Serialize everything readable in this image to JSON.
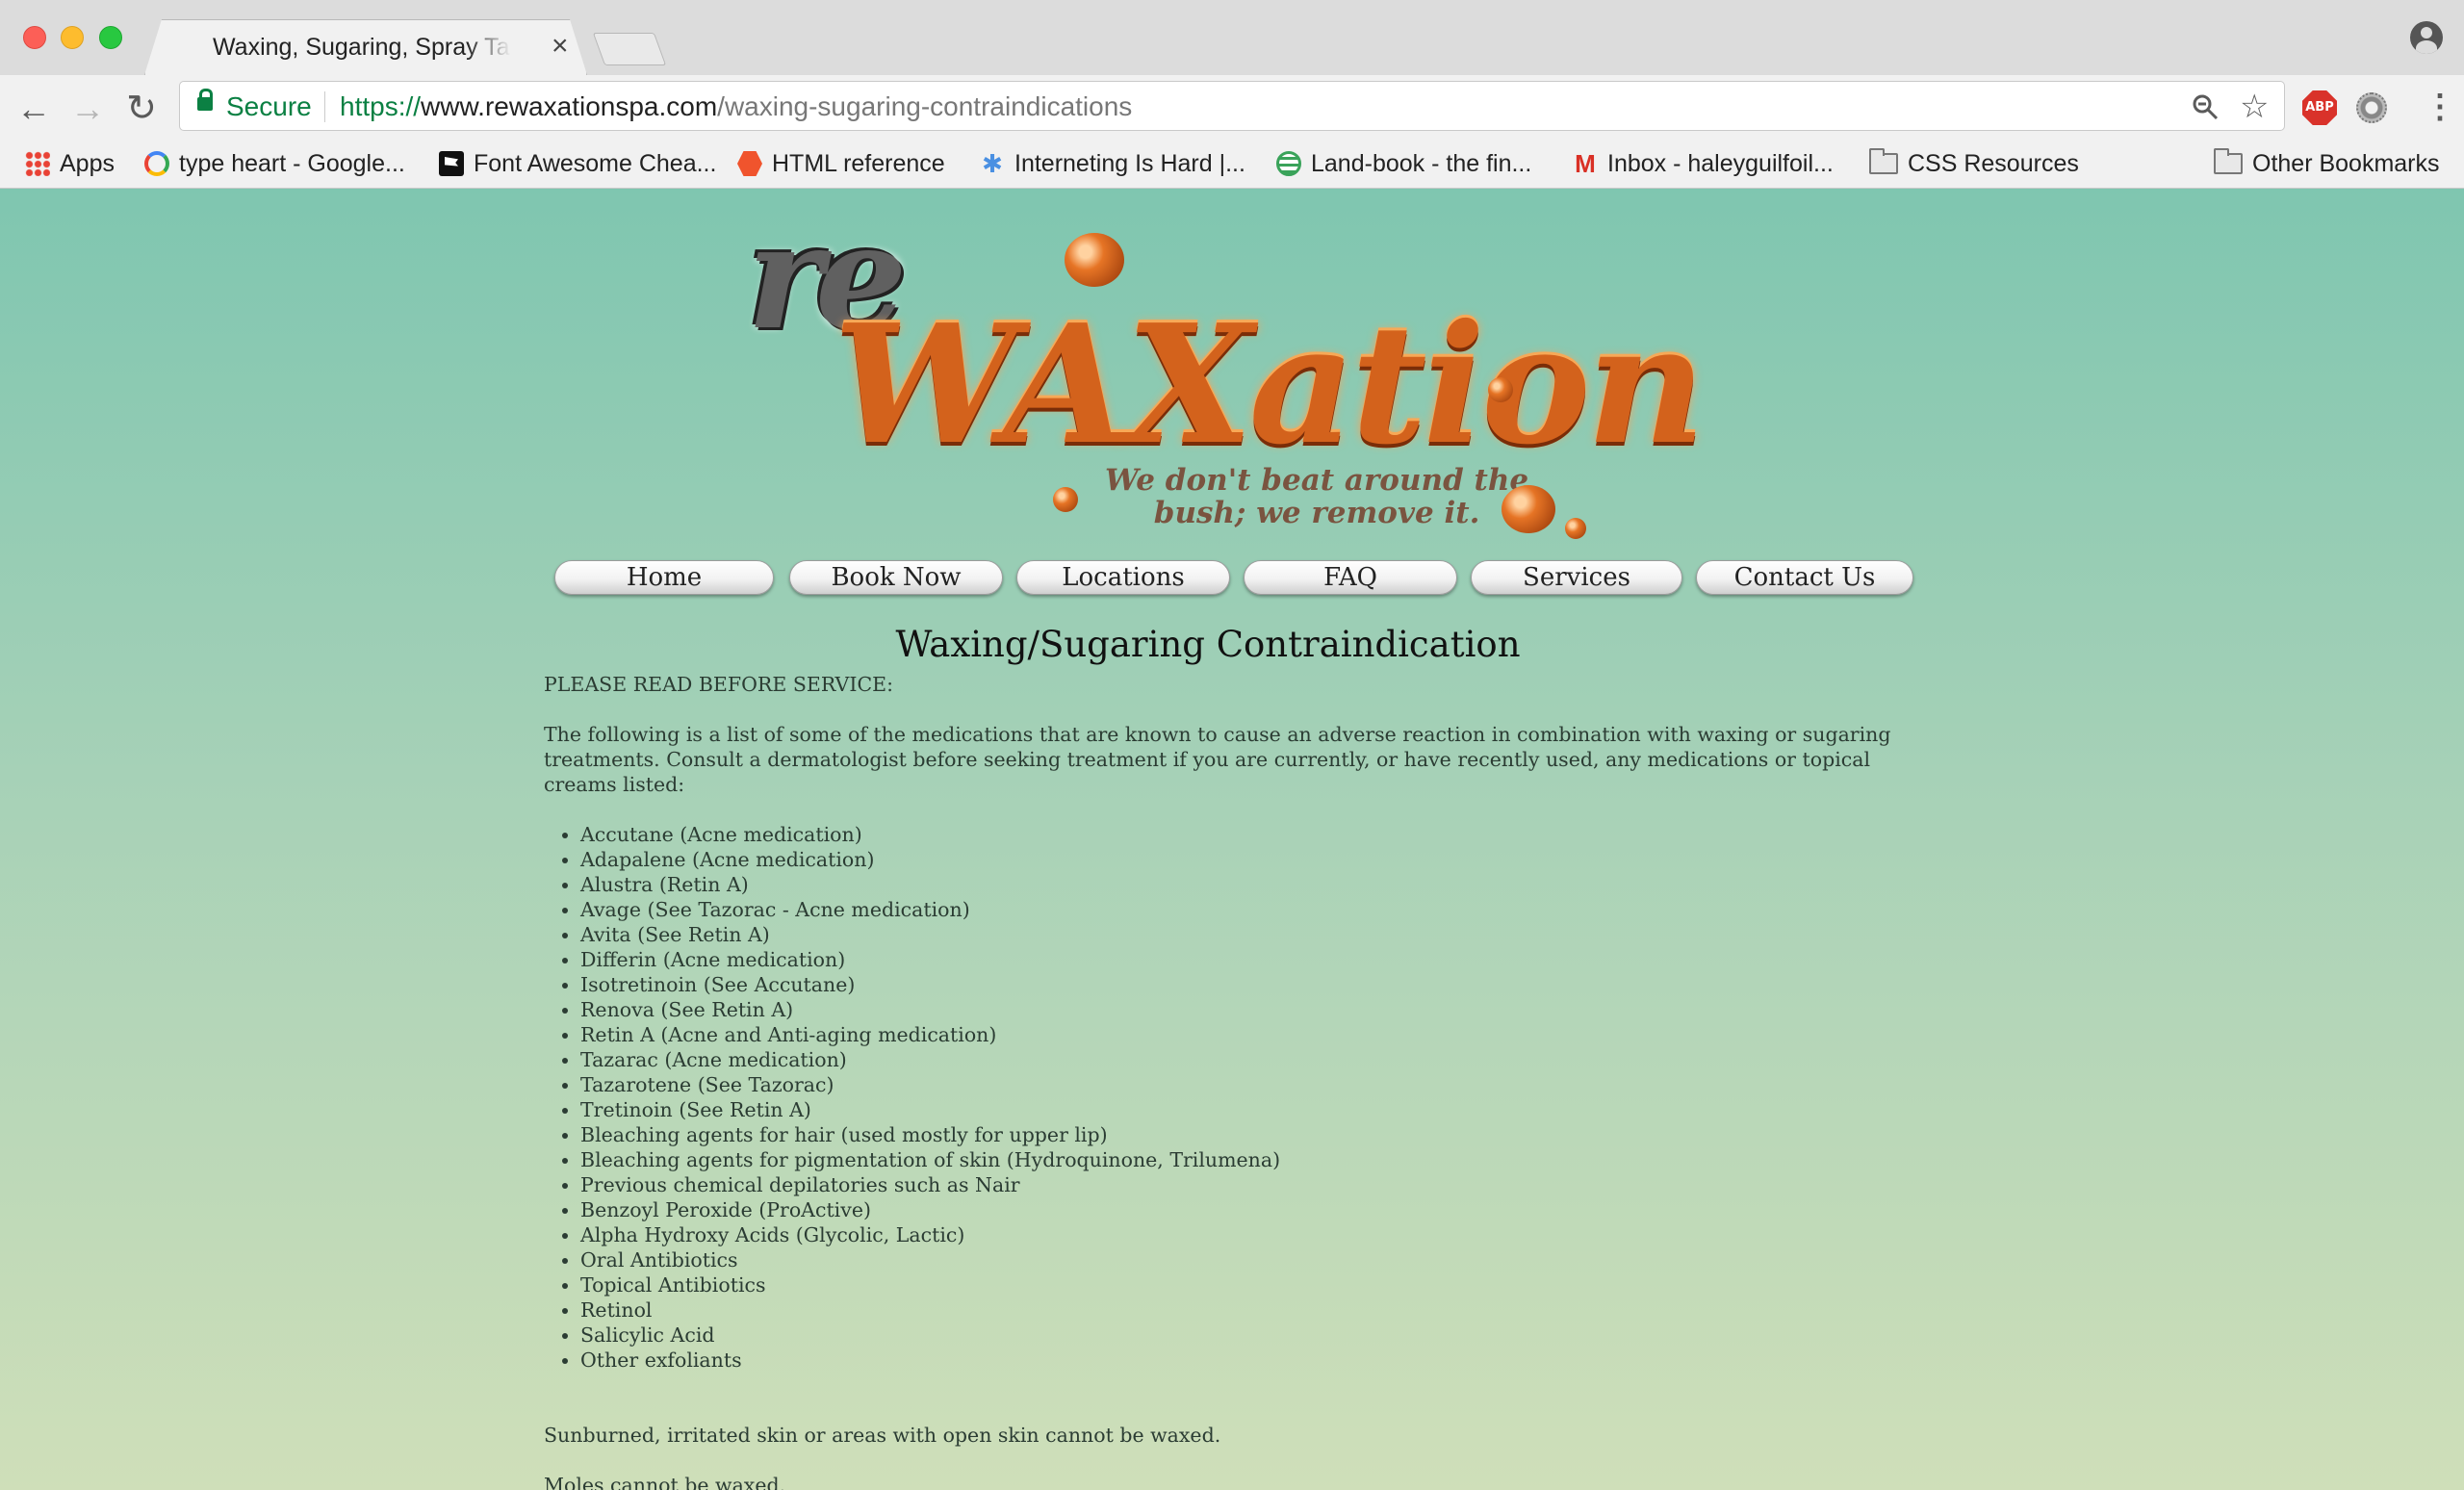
{
  "browser": {
    "tab_title": "Waxing, Sugaring, Spray Tanning",
    "tab_close": "×",
    "secure_label": "Secure",
    "url_scheme": "https://",
    "url_host": "www.rewaxationspa.com",
    "url_path": "/waxing-sugaring-contraindications",
    "abp_label": "ABP",
    "bookmarks": [
      {
        "label": "Apps",
        "icon": "apps-icon"
      },
      {
        "label": "type heart - Google...",
        "icon": "google-icon"
      },
      {
        "label": "Font Awesome Chea...",
        "icon": "font-awesome-icon"
      },
      {
        "label": "HTML reference",
        "icon": "html-reference-icon"
      },
      {
        "label": "Interneting Is Hard |...",
        "icon": "interneting-is-hard-icon"
      },
      {
        "label": "Land-book - the fin...",
        "icon": "land-book-icon"
      },
      {
        "label": "Inbox - haleyguilfoil...",
        "icon": "gmail-icon"
      },
      {
        "label": "CSS Resources",
        "icon": "folder-icon"
      }
    ],
    "other_bookmarks": "Other Bookmarks"
  },
  "site": {
    "logo": {
      "prefix": "re",
      "wordmark": "WAXation",
      "tagline_line1": "We don't beat around the",
      "tagline_line2": "bush; we remove it."
    },
    "nav": [
      "Home",
      "Book Now",
      "Locations",
      "FAQ",
      "Services",
      "Contact Us"
    ],
    "heading": "Waxing/Sugaring Contraindication",
    "notice": "PLEASE READ BEFORE SERVICE:",
    "intro": "The following is a list of some of the medications that are known to cause an adverse reaction in combination with waxing or sugaring treatments. Consult a dermatologist before seeking treatment if you are currently, or have recently used, any medications or topical creams listed:",
    "medications": [
      "Accutane (Acne medication)",
      "Adapalene (Acne medication)",
      "Alustra (Retin A)",
      "Avage (See Tazorac - Acne medication)",
      "Avita (See Retin A)",
      "Differin (Acne medication)",
      "Isotretinoin (See Accutane)",
      "Renova (See Retin A)",
      "Retin A (Acne and Anti-aging medication)",
      "Tazarac (Acne medication)",
      "Tazarotene (See Tazorac)",
      "Tretinoin (See Retin A)",
      "Bleaching agents for hair (used mostly for upper lip)",
      "Bleaching agents for pigmentation of skin (Hydroquinone, Trilumena)",
      "Previous chemical depilatories such as Nair",
      "Benzoyl Peroxide (ProActive)",
      "Alpha Hydroxy Acids (Glycolic, Lactic)",
      "Oral Antibiotics",
      "Topical Antibiotics",
      "Retinol",
      "Salicylic Acid",
      "Other exfoliants"
    ],
    "note_sunburn": "Sunburned, irritated skin or areas with open skin cannot be waxed.",
    "note_moles": "Moles cannot be waxed."
  }
}
